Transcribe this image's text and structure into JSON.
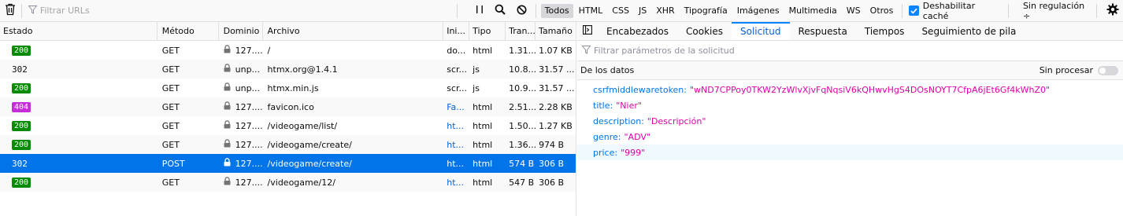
{
  "toolbar": {
    "filter_placeholder": "Filtrar URLs",
    "type_filters": [
      "Todos",
      "HTML",
      "CSS",
      "JS",
      "XHR",
      "Tipografía",
      "Imágenes",
      "Multimedia",
      "WS",
      "Otros"
    ],
    "active_filter": "Todos",
    "disable_cache_label": "Deshabilitar caché",
    "disable_cache_checked": true,
    "throttle_label": "Sin regulación ÷"
  },
  "table": {
    "headers": {
      "status": "Estado",
      "method": "Método",
      "domain": "Dominio",
      "file": "Archivo",
      "initiator": "Ini...",
      "type": "Tipo",
      "transferred": "Tran...",
      "size": "Tamaño"
    },
    "rows": [
      {
        "status": "200",
        "status_color": "#058b00",
        "method": "GET",
        "domain": "127....",
        "file": "/",
        "initiator": "do...",
        "type": "html",
        "transferred": "1.31...",
        "size": "1.07 KB"
      },
      {
        "status": "302",
        "status_color": "",
        "method": "GET",
        "domain": "unp...",
        "file": "htmx.org@1.4.1",
        "initiator": "scr...",
        "type": "js",
        "transferred": "10.8...",
        "size": "31.57 ..."
      },
      {
        "status": "200",
        "status_color": "#058b00",
        "method": "GET",
        "domain": "unp...",
        "file": "htmx.min.js",
        "initiator": "scr...",
        "type": "js",
        "transferred": "10.9...",
        "size": "31.57 ..."
      },
      {
        "status": "404",
        "status_color": "#c62dd8",
        "method": "GET",
        "domain": "127....",
        "file": "favicon.ico",
        "initiator": "Fa...",
        "type": "html",
        "transferred": "2.51...",
        "size": "2.28 KB"
      },
      {
        "status": "200",
        "status_color": "#058b00",
        "method": "GET",
        "domain": "127....",
        "file": "/videogame/list/",
        "initiator": "ht...",
        "type": "html",
        "transferred": "1.50...",
        "size": "1.27 KB"
      },
      {
        "status": "200",
        "status_color": "#058b00",
        "method": "GET",
        "domain": "127....",
        "file": "/videogame/create/",
        "initiator": "ht...",
        "type": "html",
        "transferred": "1.36...",
        "size": "974 B"
      },
      {
        "status": "302",
        "status_color": "",
        "method": "POST",
        "domain": "127....",
        "file": "/videogame/create/",
        "initiator": "ht...",
        "type": "html",
        "transferred": "574 B",
        "size": "306 B"
      },
      {
        "status": "200",
        "status_color": "#058b00",
        "method": "GET",
        "domain": "127....",
        "file": "/videogame/12/",
        "initiator": "ht...",
        "type": "html",
        "transferred": "547 B",
        "size": "306 B"
      }
    ]
  },
  "details": {
    "tabs": [
      "Encabezados",
      "Cookies",
      "Solicitud",
      "Respuesta",
      "Tiempos",
      "Seguimiento de pila"
    ],
    "active_tab": "Solicitud",
    "param_filter_placeholder": "Filtrar parámetros de la solicitud",
    "section_title": "De los datos",
    "raw_label": "Sin procesar",
    "params": [
      {
        "key": "csrfmiddlewaretoken:",
        "value": "\"wND7CPPoy0TKW2YzWlvXjvFqNqsiV6kQHwvHgS4DOsNOYT7CfpA6jEt6Gf4kWhZ0\""
      },
      {
        "key": "title:",
        "value": "\"Nier\""
      },
      {
        "key": "description:",
        "value": "\"Descripción\""
      },
      {
        "key": "genre:",
        "value": "\"ADV\""
      },
      {
        "key": "price:",
        "value": "\"999\""
      }
    ]
  }
}
